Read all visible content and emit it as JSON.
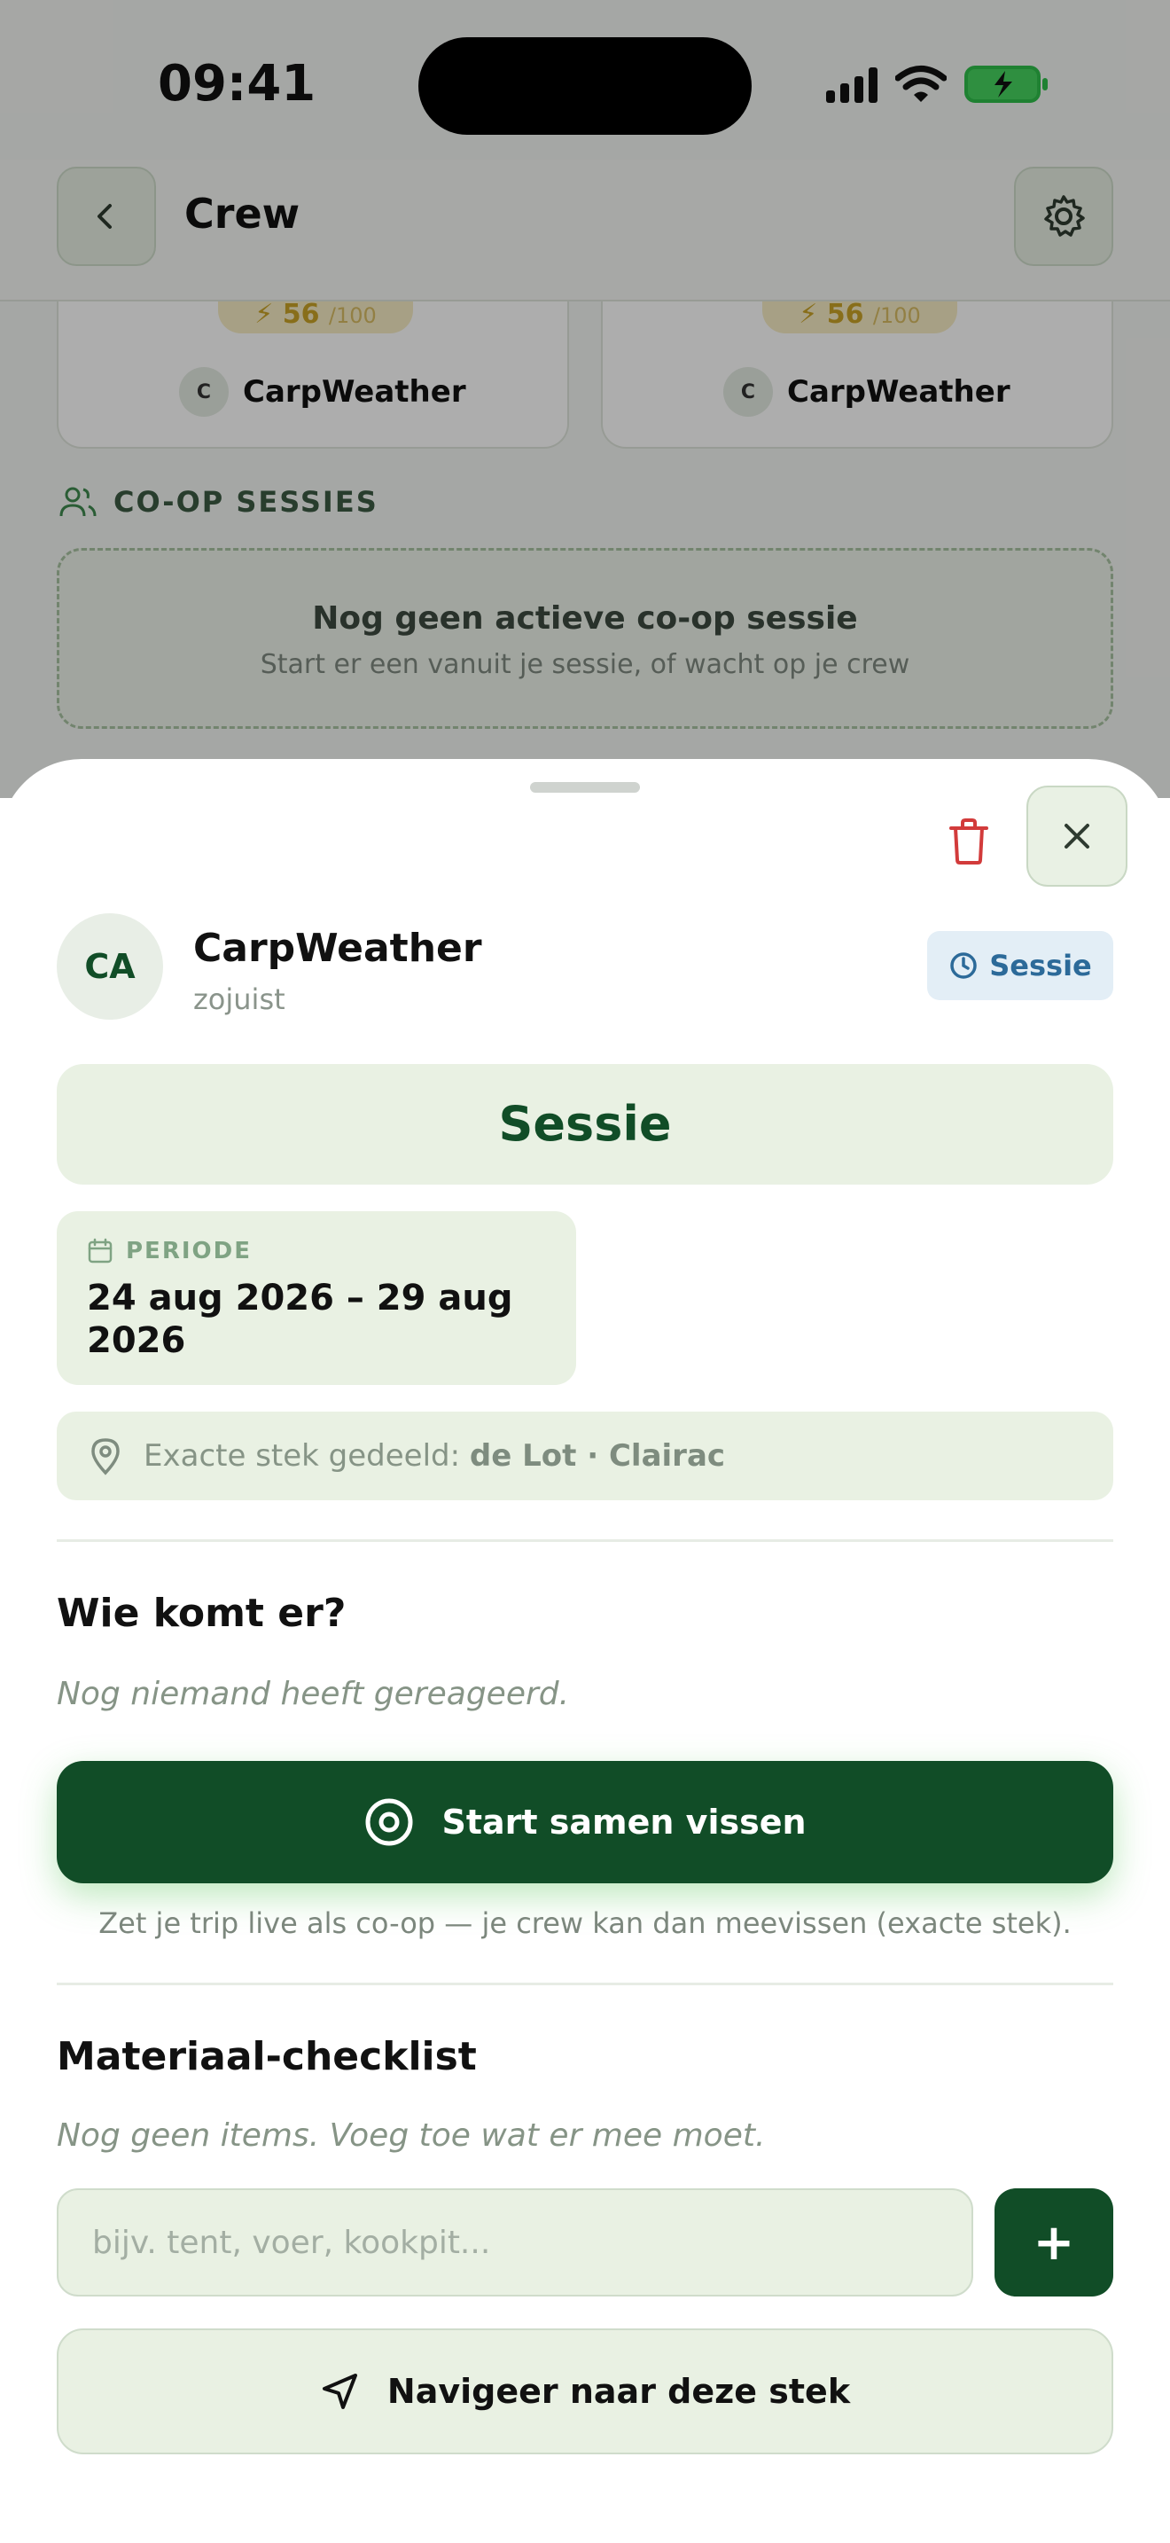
{
  "status_bar": {
    "time": "09:41"
  },
  "header": {
    "title": "Crew"
  },
  "background_cards": [
    {
      "score": "56",
      "score_max": "/100",
      "avatar_initial": "C",
      "author": "CarpWeather"
    },
    {
      "score": "56",
      "score_max": "/100",
      "avatar_initial": "C",
      "author": "CarpWeather"
    }
  ],
  "coop": {
    "heading": "CO-OP SESSIES",
    "empty_title": "Nog geen actieve co-op sessie",
    "empty_subtitle": "Start er een vanuit je sessie, of wacht op je crew"
  },
  "sheet": {
    "owner": {
      "initials": "CA",
      "name": "CarpWeather",
      "time": "zojuist"
    },
    "type_badge": "Sessie",
    "type_banner": "Sessie",
    "period": {
      "label": "PERIODE",
      "value": "24 aug 2026 – 29 aug 2026"
    },
    "location": {
      "prefix": "Exacte stek gedeeld:",
      "value": "de Lot · Clairac"
    },
    "attendance": {
      "title": "Wie komt er?",
      "empty": "Nog niemand heeft gereageerd."
    },
    "start_button": "Start samen vissen",
    "start_help": "Zet je trip live als co-op — je crew kan dan meevissen (exacte stek).",
    "checklist": {
      "title": "Materiaal-checklist",
      "empty": "Nog geen items. Voeg toe wat er mee moet.",
      "input_placeholder": "bijv. tent, voer, kookpit...",
      "add_label": "+"
    },
    "navigate_button": "Navigeer naar deze stek"
  },
  "colors": {
    "primary": "#114d27",
    "surface": "#e9f1e3",
    "badge_bg": "#e3eef6",
    "badge_text": "#2c6a99",
    "danger": "#d23b3b",
    "score": "#c9a227"
  }
}
